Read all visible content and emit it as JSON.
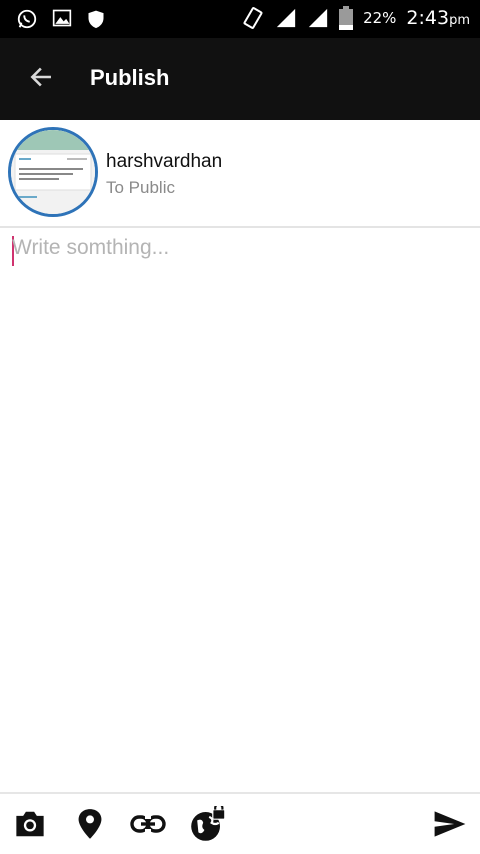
{
  "status_bar": {
    "battery_percent": "22%",
    "time": "2:43",
    "ampm": "pm",
    "icons": [
      "whatsapp-icon",
      "gallery-icon",
      "shield-icon",
      "vibrate-icon",
      "signal-icon",
      "signal-icon",
      "battery-icon"
    ]
  },
  "app_bar": {
    "title": "Publish",
    "back_icon": "arrow-back-icon"
  },
  "user": {
    "name": "harshvardhan",
    "audience": "To Public"
  },
  "compose": {
    "placeholder": "Write somthing..."
  },
  "toolbar": {
    "items": [
      "camera-icon",
      "location-pin-icon",
      "link-icon",
      "public-lock-icon",
      "send-icon"
    ]
  },
  "colors": {
    "status_bar": "#000000",
    "app_bar": "#111111",
    "avatar_border": "#2e73b8",
    "cursor": "#d0336f",
    "placeholder": "#b4b4b4"
  }
}
